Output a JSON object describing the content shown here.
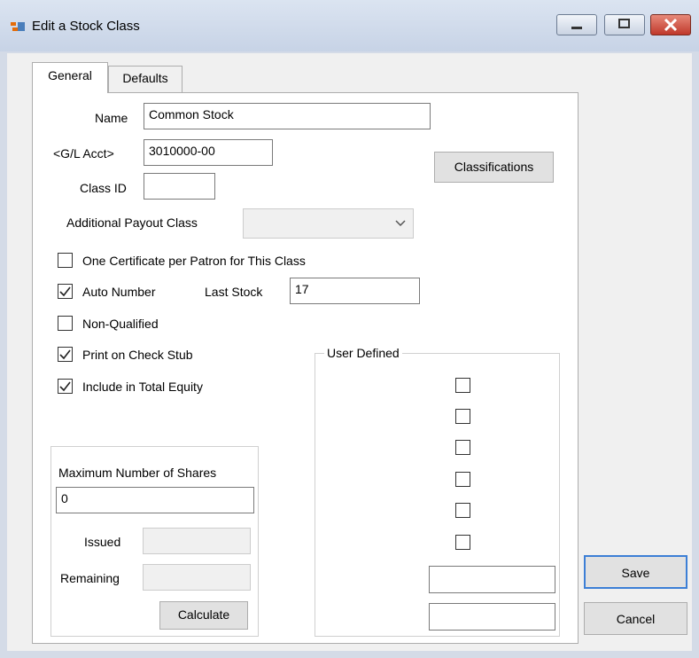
{
  "window": {
    "title": "Edit a Stock Class"
  },
  "tabs": {
    "general": "General",
    "defaults": "Defaults"
  },
  "form": {
    "name_label": "Name",
    "name_value": "Common Stock",
    "gl_label": "<G/L Acct>",
    "gl_value": "3010000-00",
    "classid_label": "Class ID",
    "classid_value": "",
    "payout_label": "Additional Payout Class",
    "payout_value": "",
    "classifications_label": "Classifications",
    "one_cert_label": "One Certificate per Patron for This Class",
    "one_cert_checked": false,
    "auto_number_label": "Auto Number",
    "auto_number_checked": true,
    "last_stock_label": "Last Stock",
    "last_stock_value": "17",
    "non_qualified_label": "Non-Qualified",
    "non_qualified_checked": false,
    "print_stub_label": "Print on Check Stub",
    "print_stub_checked": true,
    "total_equity_label": "Include in Total Equity",
    "total_equity_checked": true
  },
  "shares": {
    "max_label": "Maximum Number of Shares",
    "max_value": "0",
    "issued_label": "Issued",
    "issued_value": "",
    "remaining_label": "Remaining",
    "remaining_value": "",
    "calculate_label": "Calculate"
  },
  "user_defined": {
    "title": "User Defined",
    "checkboxes": [
      false,
      false,
      false,
      false,
      false,
      false
    ],
    "text1": "",
    "text2": ""
  },
  "actions": {
    "save": "Save",
    "cancel": "Cancel"
  }
}
